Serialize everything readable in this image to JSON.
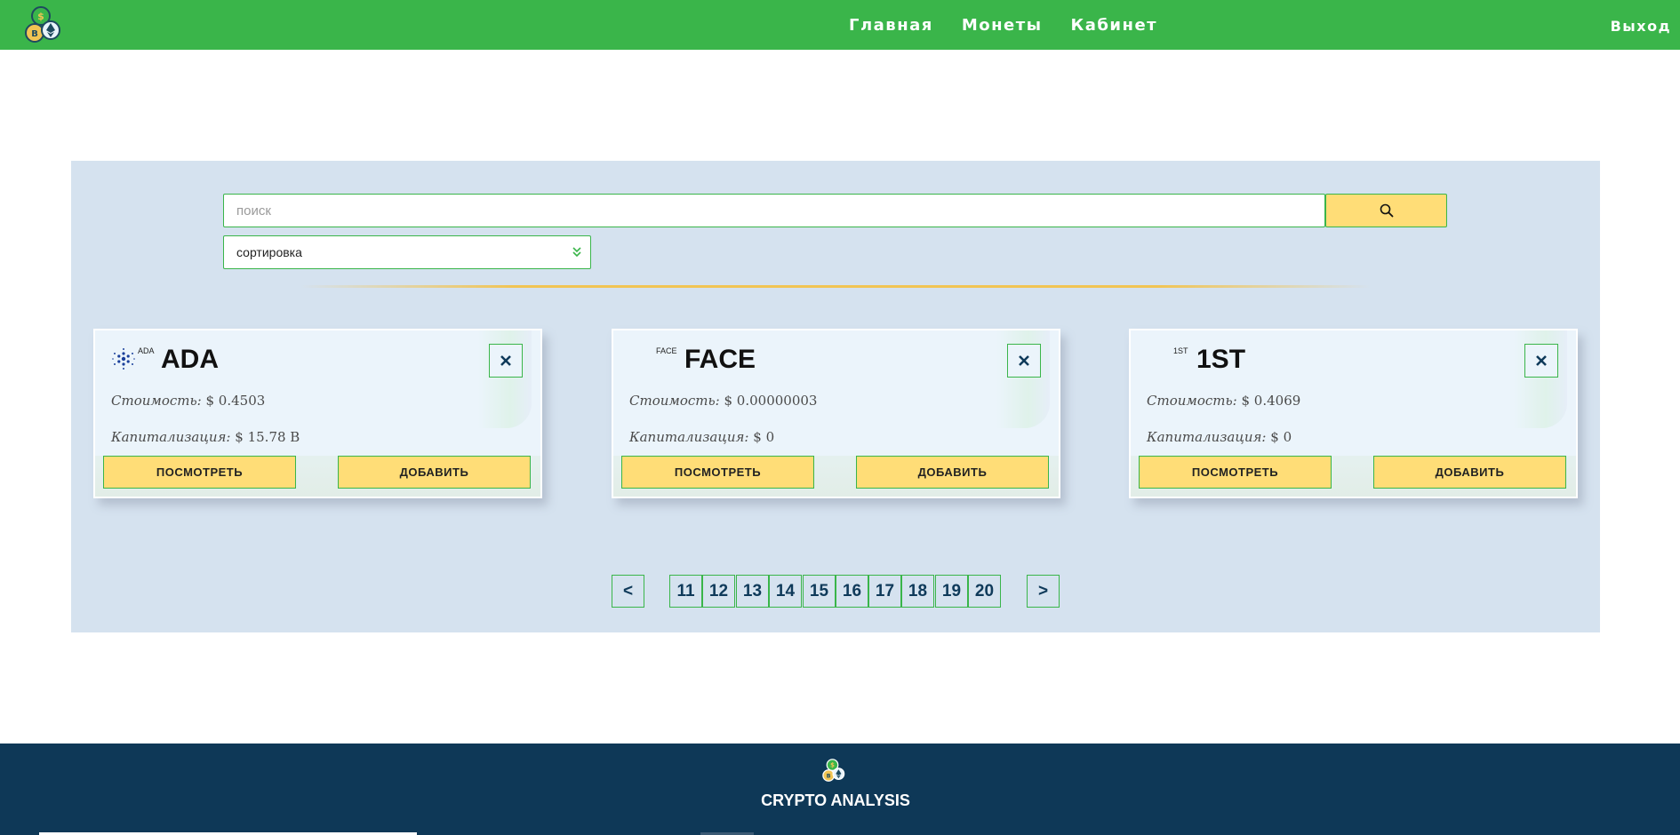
{
  "header": {
    "nav": [
      "Главная",
      "Монеты",
      "Кабинет"
    ],
    "logout": "Выход"
  },
  "search": {
    "placeholder": "поиск",
    "sort_label": "сортировка"
  },
  "cards": [
    {
      "tag": "ADA",
      "symbol": "ADA",
      "price_label": "Стоимость:",
      "price": "$ 0.4503",
      "cap_label": "Капитализация:",
      "cap": "$ 15.78 B",
      "view": "ПОСМОТРЕТЬ",
      "add": "ДОБАВИТЬ"
    },
    {
      "tag": "FACE",
      "symbol": "FACE",
      "price_label": "Стоимость:",
      "price": "$ 0.00000003",
      "cap_label": "Капитализация:",
      "cap": "$ 0",
      "view": "ПОСМОТРЕТЬ",
      "add": "ДОБАВИТЬ"
    },
    {
      "tag": "1ST",
      "symbol": "1ST",
      "price_label": "Стоимость:",
      "price": "$ 0.4069",
      "cap_label": "Капитализация:",
      "cap": "$ 0",
      "view": "ПОСМОТРЕТЬ",
      "add": "ДОБАВИТЬ"
    }
  ],
  "pagination": {
    "prev": "<",
    "next": ">",
    "pages": [
      "11",
      "12",
      "13",
      "14",
      "15",
      "16",
      "17",
      "18",
      "19",
      "20"
    ]
  },
  "footer": {
    "title": "CRYPTO ANALYSIS"
  },
  "colors": {
    "header": "#3ab54a",
    "panel": "#d5e2ef",
    "button": "#ffdd77",
    "footer": "#0e3857"
  }
}
